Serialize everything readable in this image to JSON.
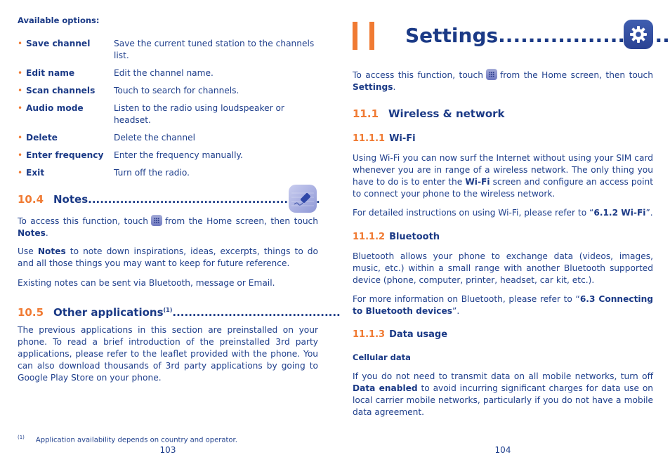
{
  "left_page": {
    "available_options_title": "Available options:",
    "options": [
      {
        "name": "Save channel",
        "desc": "Save the current tuned station to the channels list."
      },
      {
        "name": "Edit name",
        "desc": "Edit the channel name."
      },
      {
        "name": "Scan channels",
        "desc": "Touch to search for channels."
      },
      {
        "name": "Audio mode",
        "desc": "Listen to the radio using loudspeaker or headset."
      },
      {
        "name": "Delete",
        "desc": "Delete the channel"
      },
      {
        "name": "Enter frequency",
        "desc": "Enter the frequency manually."
      },
      {
        "name": "Exit",
        "desc": "Turn off the radio."
      }
    ],
    "notes_section": {
      "number": "10.4",
      "title": "Notes",
      "leader": "..........................................................",
      "icon": "notes-app-icon",
      "access_pre": "To access this function, touch",
      "access_post": "from the Home screen, then touch",
      "access_target": "Notes",
      "para2_bold": "Notes",
      "para2_pre": "Use",
      "para2_post": "to note down inspirations, ideas, excerpts, things to do and all those things you may want to keep for future reference.",
      "para3": "Existing notes can be sent via Bluetooth, message or Email."
    },
    "other_apps_section": {
      "number": "10.5",
      "title": "Other applications",
      "footnote_mark": "(1)",
      "leader": "..........................................",
      "para": "The previous applications in this section are preinstalled on your phone. To read a brief introduction of the preinstalled 3rd party applications, please refer to the leaflet provided with the phone. You can also download thousands of 3rd party applications by going to Google Play Store on your phone."
    },
    "footnote": {
      "mark": "(1)",
      "text": "Application availability depends on country and operator."
    },
    "page_number": "103"
  },
  "right_page": {
    "chapter": {
      "number": "11",
      "title": "Settings",
      "leader": "..........................",
      "icon": "settings-gear-icon"
    },
    "intro": {
      "access_pre": "To access this function, touch",
      "access_post": "from the Home screen, then touch",
      "access_target": "Settings"
    },
    "section_11_1": {
      "number": "11.1",
      "title": "Wireless & network"
    },
    "wifi": {
      "number": "11.1.1",
      "title": "Wi-Fi",
      "para1_pre": "Using Wi-Fi you can now surf the Internet without using your SIM card whenever you are in range of a wireless network. The only thing you have to do is to enter the",
      "para1_bold": "Wi-Fi",
      "para1_post": "screen and configure an access point to connect your phone to the wireless network.",
      "para2_pre": "For detailed instructions on using Wi-Fi, please refer to “",
      "para2_bold": "6.1.2 Wi-Fi",
      "para2_post": "”."
    },
    "bluetooth": {
      "number": "11.1.2",
      "title": "Bluetooth",
      "para1": "Bluetooth allows your phone to exchange data (videos, images, music, etc.) within a small range with another Bluetooth supported device (phone, computer, printer, headset, car kit, etc.).",
      "para2_pre": "For more information on Bluetooth, please refer to “",
      "para2_bold": "6.3 Connecting to Bluetooth devices",
      "para2_post": "”."
    },
    "data_usage": {
      "number": "11.1.3",
      "title": "Data usage",
      "subheading": "Cellular data",
      "para_pre": "If you do not need to transmit data on all mobile networks, turn off",
      "para_bold": "Data enabled",
      "para_post": "to avoid incurring significant charges for data use on local carrier mobile networks, particularly if you do not have a mobile data agreement."
    },
    "page_number": "104"
  },
  "colors": {
    "text": "#1f3f8c",
    "heading": "#1b3a86",
    "accent": "#f07a32"
  }
}
